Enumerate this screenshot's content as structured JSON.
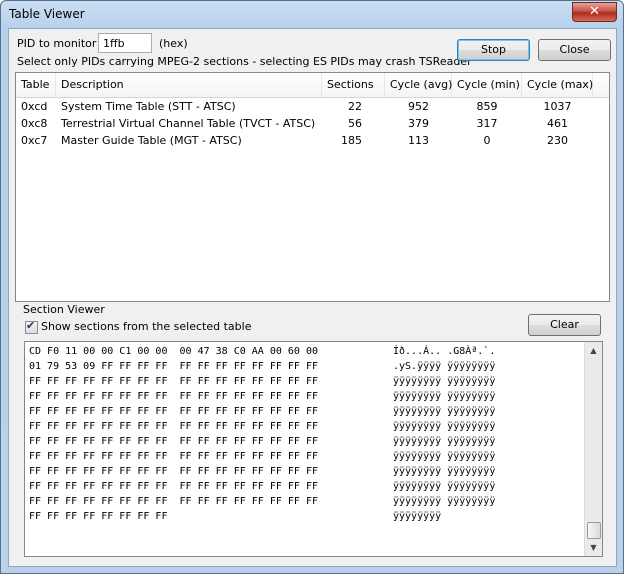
{
  "window": {
    "title": "Table Viewer",
    "close_glyph": "✕"
  },
  "pid": {
    "label": "PID to monitor",
    "value": "1ffb",
    "unit": "(hex)"
  },
  "warning": "Select only PIDs carrying MPEG-2 sections - selecting ES PIDs may crash TSReader",
  "buttons": {
    "stop": "Stop",
    "close": "Close",
    "clear": "Clear"
  },
  "table": {
    "columns": [
      "Table",
      "Description",
      "Sections",
      "Cycle (avg)",
      "Cycle (min)",
      "Cycle (max)"
    ],
    "rows": [
      [
        "0xcd",
        "System Time Table (STT - ATSC)",
        "22",
        "952",
        "859",
        "1037"
      ],
      [
        "0xc8",
        "Terrestrial Virtual Channel Table (TVCT - ATSC)",
        "56",
        "379",
        "317",
        "461"
      ],
      [
        "0xc7",
        "Master Guide Table (MGT - ATSC)",
        "185",
        "113",
        "0",
        "230"
      ]
    ]
  },
  "section_viewer": {
    "label": "Section Viewer",
    "checkbox_label": "Show sections from the selected table",
    "checked": true,
    "hex_lines": [
      "CD F0 11 00 00 C1 00 00  00 47 38 C0 AA 00 60 00",
      "01 79 53 09 FF FF FF FF  FF FF FF FF FF FF FF FF",
      "FF FF FF FF FF FF FF FF  FF FF FF FF FF FF FF FF",
      "FF FF FF FF FF FF FF FF  FF FF FF FF FF FF FF FF",
      "FF FF FF FF FF FF FF FF  FF FF FF FF FF FF FF FF",
      "FF FF FF FF FF FF FF FF  FF FF FF FF FF FF FF FF",
      "FF FF FF FF FF FF FF FF  FF FF FF FF FF FF FF FF",
      "FF FF FF FF FF FF FF FF  FF FF FF FF FF FF FF FF",
      "FF FF FF FF FF FF FF FF  FF FF FF FF FF FF FF FF",
      "FF FF FF FF FF FF FF FF  FF FF FF FF FF FF FF FF",
      "FF FF FF FF FF FF FF FF  FF FF FF FF FF FF FF FF",
      "FF FF FF FF FF FF FF FF"
    ],
    "ascii_lines": [
      "Íð...Á.. .G8Àª.`.",
      ".yS.ÿÿÿÿ ÿÿÿÿÿÿÿÿ",
      "ÿÿÿÿÿÿÿÿ ÿÿÿÿÿÿÿÿ",
      "ÿÿÿÿÿÿÿÿ ÿÿÿÿÿÿÿÿ",
      "ÿÿÿÿÿÿÿÿ ÿÿÿÿÿÿÿÿ",
      "ÿÿÿÿÿÿÿÿ ÿÿÿÿÿÿÿÿ",
      "ÿÿÿÿÿÿÿÿ ÿÿÿÿÿÿÿÿ",
      "ÿÿÿÿÿÿÿÿ ÿÿÿÿÿÿÿÿ",
      "ÿÿÿÿÿÿÿÿ ÿÿÿÿÿÿÿÿ",
      "ÿÿÿÿÿÿÿÿ ÿÿÿÿÿÿÿÿ",
      "ÿÿÿÿÿÿÿÿ ÿÿÿÿÿÿÿÿ",
      "ÿÿÿÿÿÿÿÿ"
    ]
  }
}
